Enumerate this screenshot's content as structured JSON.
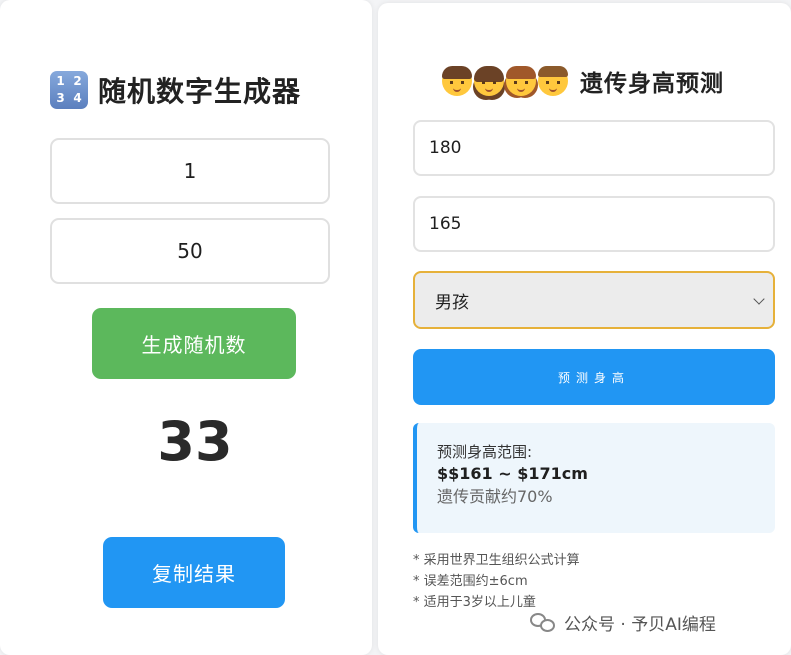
{
  "random_generator": {
    "icon": "input-numbers-icon",
    "icon_digits": [
      "1",
      "2",
      "3",
      "4"
    ],
    "title": "随机数字生成器",
    "min_value": "1",
    "max_value": "50",
    "generate_label": "生成随机数",
    "result": "33",
    "copy_label": "复制结果",
    "colors": {
      "generate_button": "#5cb85c",
      "copy_button": "#2196f3"
    }
  },
  "height_predictor": {
    "title_emojis": [
      "man-emoji",
      "woman-emoji",
      "girl-emoji",
      "boy-emoji"
    ],
    "title": "遗传身高预测",
    "father_height": "180",
    "mother_height": "165",
    "gender_selected": "男孩",
    "predict_label": "预测身高",
    "result": {
      "label": "预测身高范围:",
      "range": "$$161 ~ $171cm",
      "contribution": "遗传贡献约70%"
    },
    "notes": [
      "* 采用世界卫生组织公式计算",
      "* 误差范围约±6cm",
      "* 适用于3岁以上儿童"
    ],
    "colors": {
      "predict_button": "#2196f3",
      "select_border": "#e6b13a",
      "result_accent": "#2196f3"
    }
  },
  "watermark": {
    "icon": "wechat-icon",
    "text": "公众号 · 予贝AI编程"
  }
}
